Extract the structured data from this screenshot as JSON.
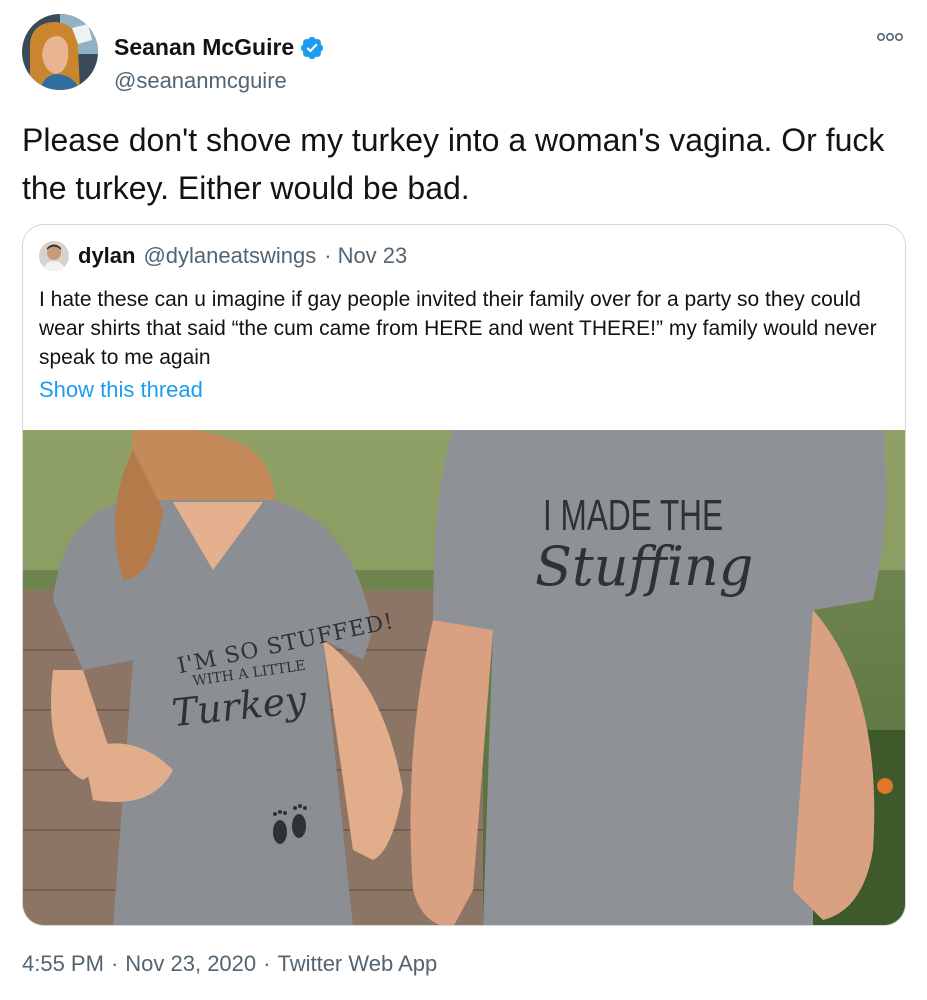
{
  "author": {
    "display_name": "Seanan McGuire",
    "handle": "@seananmcguire",
    "verified_icon": "verified-badge-icon",
    "more_icon": "more-options-icon"
  },
  "tweet": {
    "text": "Please don't shove my turkey into a woman's vagina. Or fuck the turkey. Either would be bad."
  },
  "quoted": {
    "display_name": "dylan",
    "handle": "@dylaneatswings",
    "separator": "·",
    "date": "Nov 23",
    "text": "I hate these can u imagine if gay people invited their family over for a party so they could wear shirts that said “the cum came from HERE and went THERE!” my family would never speak to me again",
    "show_thread": "Show this thread",
    "photo": {
      "left_shirt_line1": "I'M SO STUFFED!",
      "left_shirt_line2": "WITH A LITTLE",
      "left_shirt_line3": "Turkey",
      "right_shirt_line1": "I MADE THE",
      "right_shirt_line2": "Stuffing"
    }
  },
  "footer": {
    "time": "4:55 PM",
    "sep1": "·",
    "date": "Nov 23, 2020",
    "sep2": "·",
    "source": "Twitter Web App"
  },
  "colors": {
    "text": "#0f1419",
    "secondary": "#536471",
    "link": "#1d9bf0",
    "border": "#cfd9de",
    "verified": "#1d9bf0"
  }
}
